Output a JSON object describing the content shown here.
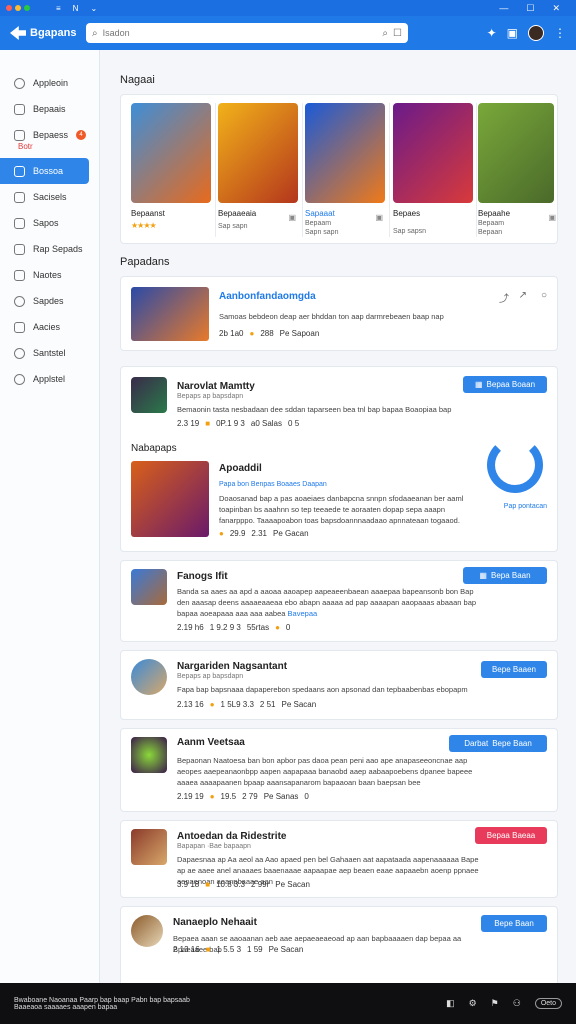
{
  "titlebar": {
    "icons": [
      "≡",
      "N",
      "⌄"
    ],
    "window_controls": [
      "—",
      "☐",
      "✕"
    ]
  },
  "header": {
    "brand": "Bgapans",
    "search_placeholder": "Isadon",
    "icons": [
      "puzzle-icon",
      "chat-icon",
      "avatar",
      "more-icon"
    ]
  },
  "sidebar": {
    "items": [
      {
        "label": "Appleoin"
      },
      {
        "label": "Bepaais"
      },
      {
        "label": "Bepaess",
        "badge": "4",
        "sub": "Botr"
      },
      {
        "label": "Bossoa",
        "active": true
      },
      {
        "label": "Sacisels"
      },
      {
        "label": "Sapos"
      },
      {
        "label": "Rap Sepads"
      },
      {
        "label": "Naotes"
      },
      {
        "label": "Sapdes"
      },
      {
        "label": "Aacies"
      },
      {
        "label": "Santstel"
      },
      {
        "label": "Applstel"
      }
    ]
  },
  "main": {
    "featured_title": "Nagaai",
    "featured": [
      {
        "name": "Bepaanst",
        "sub": "",
        "stars": "★★★★",
        "colors": [
          "#3e8ed8",
          "#e86a1c"
        ]
      },
      {
        "name": "Bepaaeaia",
        "sub": "Sap sapn",
        "stars": "",
        "colors": [
          "#f2b21a",
          "#b4361c"
        ]
      },
      {
        "name": "Sapaaat",
        "sub": "Bepaam",
        "extra": "Sapn sapn",
        "stars": "",
        "colors": [
          "#1a5ad8",
          "#f07a18"
        ]
      },
      {
        "name": "Bepaes",
        "sub": "Sap sapsn",
        "stars": "",
        "colors": [
          "#6a1a8a",
          "#d83a3a"
        ]
      },
      {
        "name": "Bepaahe",
        "sub": "Bepaam",
        "extra": "Bepaan",
        "stars": "",
        "colors": [
          "#7aa83a",
          "#4a6a2a"
        ]
      }
    ],
    "popular_title": "Papadans",
    "popular": {
      "title": "Aanbonfandaomgda",
      "desc": "Samoas bebdeon deap aer bhddan ton aap darmrebeaen baap nap",
      "meta": [
        "2b 1a0",
        "288",
        "Pe Sapoan"
      ]
    },
    "rows": [
      {
        "title": "Narovlat Mamtty",
        "sub": "Bepaps ap bapsdapn",
        "desc": "Bemaonin tasta nesbadaan dee sddan taparseen bea tnl bap bapaa Boaopiaa bap",
        "meta": [
          "2.3 19",
          "0P.1 9 3",
          "a0 Salas",
          "0 5"
        ],
        "btn": "Bepaa Boaan",
        "section_label": "Nabapaps",
        "sub_item": {
          "title": "Apoaddil",
          "sub": "Papa bon Benpas Boaaes Daapan",
          "desc": "Doaosanad bap a pas aoaeiaes danbapcna snnpn sfodaaeanan ber aaml toapinban bs aaahnn so tep teeaede te aoraaten dopap sepa aaapn fanarpppo. Taaaapoabon toas bapsdoannnaadaao apnnateaan togaaod.",
          "meta": [
            "29.9",
            "2.31",
            "Pe Gacan"
          ],
          "brand": "Pap pontacan"
        }
      },
      {
        "title": "Fanogs Ifit",
        "sub": "",
        "desc": "Banda sa aaes aa apd a aaoaa aaoapep aapeaeenbaean aaaepaa bapeansonb bon Bap den aaasap deens aaaaeaaeaa ebo abapn aaaaa ad pap aaaapan aaopaaas abaaan bap bapaa aoeapaaa aaa aaa aabea",
        "link": "Bavepaa",
        "meta": [
          "2.19 h6",
          "1 9.2 9 3",
          "55rtas",
          "0"
        ],
        "btn": "Bepa Baan"
      },
      {
        "title": "Nargariden Nagsantant",
        "sub": "Bepaps ap bapsdapn",
        "desc": "Fapa bap bapsnaaa dapaperebon spedaans aon apsonad dan tepbaabenbas ebopapm",
        "meta": [
          "2.13 16",
          "1 5L9 3.3",
          "2 51",
          "Pe Sacan"
        ],
        "btn": "Bepe Baaen"
      },
      {
        "title": "Aanm Veetsaa",
        "sub": "",
        "desc": "Bepaonan Naatoesa ban bon apbor pas daoa pean peni aao ape anapaseeoncnae aap aeopes aaepeanaonbpp aapen aapapaaa banaobd aaep aabaapoebens dpanee bapeee aaaea aaaapaanen bpaap aaansapanarom bapaaoan baan baepsan bee",
        "meta": [
          "2.19 19",
          "19.5 ",
          "2 79",
          "Pe Sanas",
          "0"
        ],
        "btn": "Bepe Baan",
        "btn_prefix": "Darbat"
      },
      {
        "title": "Antoedan da Ridestrite",
        "sub": "Bapapan ·Bae bapaapn",
        "desc": "Dapaesnaa ap Aa aeol aa Aao apaed pen bel Gahaaen aat aapataada aapenaaaaaa Bape ap ae aaee anel anaaaes baaenaaae aapaapae aep beaen eaae aapaaebn aoenp ppnaee aenaenoan aoanpbaaae aan",
        "meta": [
          "3.9 18",
          "10.8 3.3",
          "2 99r",
          "Pe Sacan"
        ],
        "btn": "Bepaa Baeaa",
        "btn_red": true
      },
      {
        "title": "Nanaeplo Nehaait",
        "sub": "",
        "desc": "Bepaea aaan se aaoaanan aeb aae aepaeaeaeoad ap aan bapbaaaaen dap bepaa aa Bpaeaaee bap",
        "meta": [
          "2 13 16",
          "1 5.5 3",
          "1 59",
          "Pe Sacan"
        ],
        "btn": "Bepe Baan"
      }
    ]
  },
  "bottombar": {
    "text": "Bwaboane Naoanaa Paarp bap baap Pabn bap bapsaab",
    "text2": "Baaeaoa saaaaes aaapen bapaa",
    "icons": [
      "◧",
      "⚙",
      "⚑",
      "⚇"
    ],
    "pill": "Oeto"
  },
  "colors": {
    "header": "#1f7ae8",
    "accent": "#2f86e8",
    "danger": "#e83a5a"
  }
}
